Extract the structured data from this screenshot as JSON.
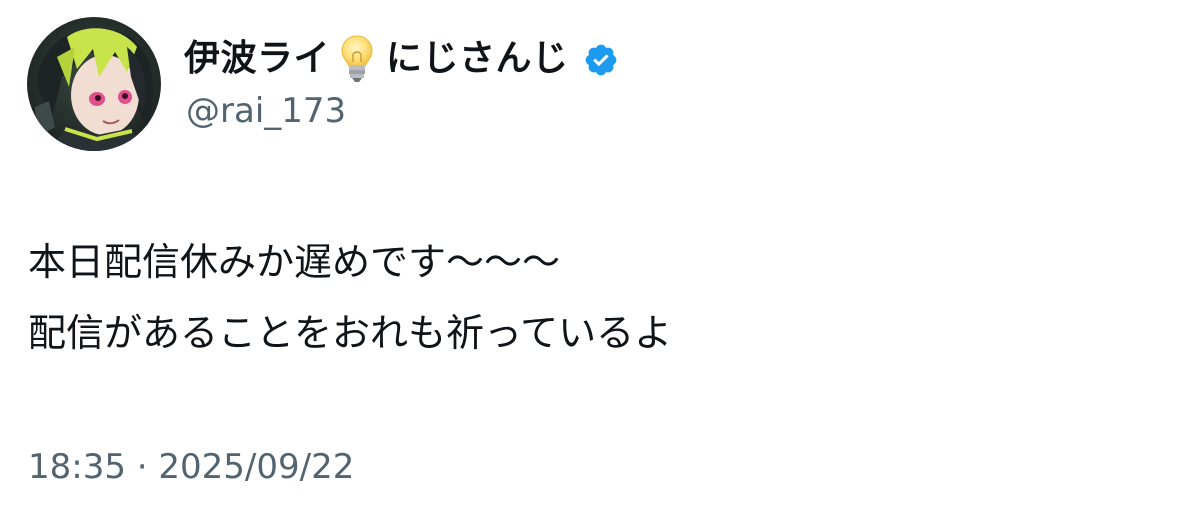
{
  "author": {
    "display_name": "伊波ライ",
    "name_suffix": "にじさんじ",
    "handle": "@rai_173",
    "icons": [
      "avatar",
      "lightbulb-icon",
      "verified-badge-icon"
    ],
    "verified_color": "#1d9bf0"
  },
  "tweet": {
    "lines": [
      "本日配信休みか遅めです〜〜〜",
      "配信があることをおれも祈っているよ"
    ],
    "timestamp": "18:35 · 2025/09/22"
  },
  "colors": {
    "text": "#0f1419",
    "secondary_text": "#536471",
    "background": "#ffffff"
  }
}
